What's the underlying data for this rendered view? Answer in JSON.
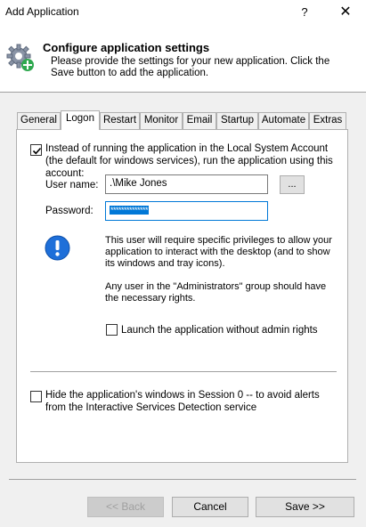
{
  "window": {
    "title": "Add Application",
    "help_label": "?",
    "close_label": "✕"
  },
  "header": {
    "title": "Configure application settings",
    "description": "Please provide the settings for your new application. Click the Save button to add the application.",
    "icon": "gear-plus-icon"
  },
  "tabs": [
    {
      "label": "General"
    },
    {
      "label": "Logon",
      "active": true
    },
    {
      "label": "Restart"
    },
    {
      "label": "Monitor"
    },
    {
      "label": "Email"
    },
    {
      "label": "Startup"
    },
    {
      "label": "Automate"
    },
    {
      "label": "Extras"
    }
  ],
  "logon": {
    "run_as_account": {
      "checked": true,
      "label": "Instead of running the application in the Local System Account (the default for windows services), run the application using this account:"
    },
    "user_name": {
      "label": "User name:",
      "value": ".\\Mike Jones"
    },
    "browse_label": "...",
    "password": {
      "label": "Password:",
      "value": "**************"
    },
    "info_icon": "exclamation-icon",
    "info_text_1": "This user will require specific privileges to allow your application to interact with the desktop (and to show its windows and tray icons).",
    "info_text_2": "Any user in the \"Administrators\" group should have the necessary rights.",
    "launch_without_admin": {
      "checked": false,
      "label": "Launch the application without admin rights"
    },
    "hide_windows": {
      "checked": false,
      "label": "Hide the application's windows in Session 0 -- to avoid alerts from the Interactive Services Detection service"
    }
  },
  "footer": {
    "back_label": "<< Back",
    "cancel_label": "Cancel",
    "save_label": "Save >>"
  },
  "colors": {
    "accent": "#0078d7",
    "info_icon": "#1e6fd9"
  }
}
